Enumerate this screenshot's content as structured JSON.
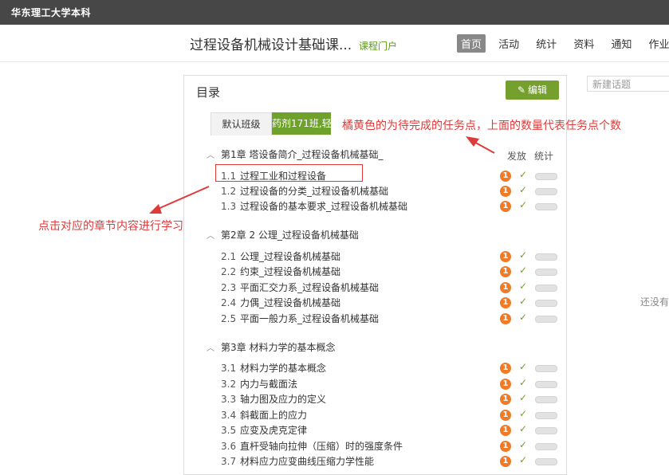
{
  "topbar": {
    "school_name": "华东理工大学本科"
  },
  "header": {
    "course_title": "过程设备机械设计基础课...",
    "course_portal": "课程门户",
    "nav": [
      {
        "label": "首页",
        "active": true
      },
      {
        "label": "活动",
        "active": false
      },
      {
        "label": "统计",
        "active": false
      },
      {
        "label": "资料",
        "active": false
      },
      {
        "label": "通知",
        "active": false
      },
      {
        "label": "作业",
        "active": false
      }
    ]
  },
  "catalog": {
    "title": "目录",
    "edit_label": "编辑",
    "tabs": [
      "默认班级",
      "药剂171班,轻"
    ],
    "col_publish": "发放",
    "col_stats": "统计"
  },
  "chapters": [
    {
      "title": "第1章 塔设备简介_过程设备机械基础_",
      "items": [
        {
          "num": "1.1",
          "title": "过程工业和过程设备",
          "badge": "1"
        },
        {
          "num": "1.2",
          "title": "过程设备的分类_过程设备机械基础",
          "badge": "1"
        },
        {
          "num": "1.3",
          "title": "过程设备的基本要求_过程设备机械基础",
          "badge": "1"
        }
      ]
    },
    {
      "title": "第2章 2 公理_过程设备机械基础",
      "items": [
        {
          "num": "2.1",
          "title": "公理_过程设备机械基础",
          "badge": "1"
        },
        {
          "num": "2.2",
          "title": "约束_过程设备机械基础",
          "badge": "1"
        },
        {
          "num": "2.3",
          "title": "平面汇交力系_过程设备机械基础",
          "badge": "1"
        },
        {
          "num": "2.4",
          "title": "力偶_过程设备机械基础",
          "badge": "1"
        },
        {
          "num": "2.5",
          "title": "平面一般力系_过程设备机械基础",
          "badge": "1"
        }
      ]
    },
    {
      "title": "第3章 材料力学的基本概念",
      "items": [
        {
          "num": "3.1",
          "title": "材料力学的基本概念",
          "badge": "1"
        },
        {
          "num": "3.2",
          "title": "内力与截面法",
          "badge": "1"
        },
        {
          "num": "3.3",
          "title": "轴力图及应力的定义",
          "badge": "1"
        },
        {
          "num": "3.4",
          "title": "斜截面上的应力",
          "badge": "1"
        },
        {
          "num": "3.5",
          "title": "应变及虎克定律",
          "badge": "1"
        },
        {
          "num": "3.6",
          "title": "直杆受轴向拉伸（压缩）时的强度条件",
          "badge": "1"
        },
        {
          "num": "3.7",
          "title": "材料应力应变曲线压缩力学性能",
          "badge": "1"
        }
      ]
    }
  ],
  "sidebar": {
    "new_topic_placeholder": "新建话题",
    "empty_text": "还没有"
  },
  "annotations": {
    "orange_note": "橘黄色的为待完成的任务点，上面的数量代表任务点个数",
    "click_note": "点击对应的章节内容进行学习"
  },
  "colors": {
    "badge": "#f07a26",
    "accent_green": "#6fa22a",
    "annotation_red": "#e03a3a"
  }
}
